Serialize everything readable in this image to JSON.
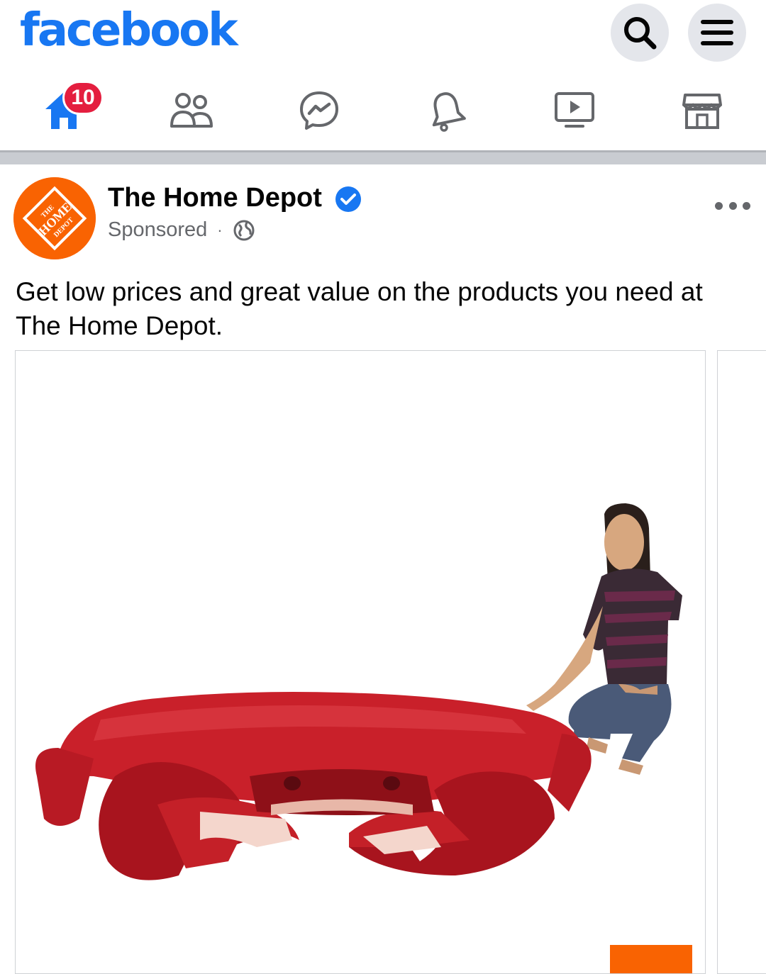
{
  "app": {
    "logo_text": "facebook",
    "brand_color": "#1877f2"
  },
  "header": {
    "search_icon": "search-icon",
    "menu_icon": "hamburger-menu-icon"
  },
  "nav": {
    "items": [
      {
        "name": "home",
        "icon": "home-icon",
        "active": true,
        "badge": "10"
      },
      {
        "name": "friends",
        "icon": "friends-icon"
      },
      {
        "name": "messenger",
        "icon": "messenger-icon"
      },
      {
        "name": "notifications",
        "icon": "bell-icon"
      },
      {
        "name": "watch",
        "icon": "video-icon"
      },
      {
        "name": "marketplace",
        "icon": "marketplace-icon"
      }
    ],
    "badge_color": "#e41e3f"
  },
  "post": {
    "page_name": "The Home Depot",
    "verified": true,
    "meta_label": "Sponsored",
    "meta_separator": "·",
    "audience_icon": "globe-icon",
    "more_icon": "more-options-icon",
    "body_text": "Get low prices and great value on the products you need at The Home Depot.",
    "avatar_logo_text": [
      "THE",
      "HOME",
      "DEPOT"
    ],
    "avatar_color": "#f96302",
    "media": {
      "description": "giant-crab-statue-product-photo"
    }
  }
}
